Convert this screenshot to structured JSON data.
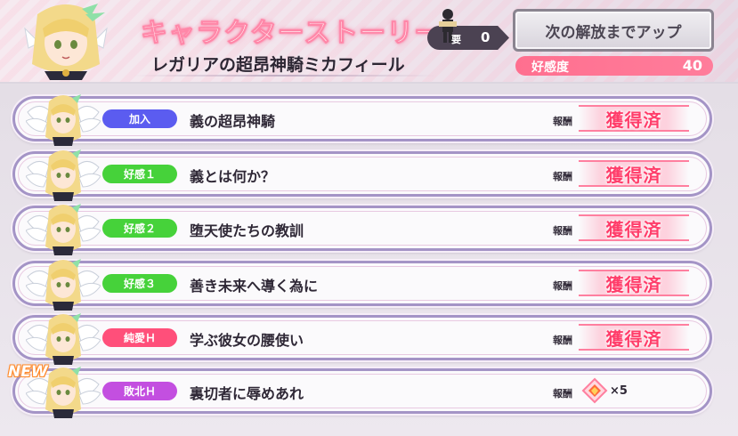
{
  "header": {
    "section_title": "キャラクターストーリー",
    "character_name": "レガリアの超昂神騎ミカフィール",
    "requirement": {
      "label": "要",
      "value": "0"
    },
    "unlock_button_label": "次の解放までアップ",
    "affection": {
      "label": "好感度",
      "value": "40"
    }
  },
  "colors": {
    "accent_pink": "#ff6f8f",
    "badge_join": "#5b5cf0",
    "badge_affection": "#46d23a",
    "badge_pure": "#ff4f7a",
    "badge_defeat": "#c34fe0"
  },
  "stories": [
    {
      "badge": "加入",
      "badge_color": "#5b5cf0",
      "title": "義の超昂神騎",
      "reward_label": "報酬",
      "reward": "獲得済"
    },
    {
      "badge": "好感１",
      "badge_color": "#46d23a",
      "title": "義とは何か？",
      "reward_label": "報酬",
      "reward": "獲得済"
    },
    {
      "badge": "好感２",
      "badge_color": "#46d23a",
      "title": "堕天使たちの教訓",
      "reward_label": "報酬",
      "reward": "獲得済"
    },
    {
      "badge": "好感３",
      "badge_color": "#46d23a",
      "title": "善き未来へ導く為に",
      "reward_label": "報酬",
      "reward": "獲得済"
    },
    {
      "badge": "純愛Ｈ",
      "badge_color": "#ff4f7a",
      "title": "学ぶ彼女の腰使い",
      "reward_label": "報酬",
      "reward": "獲得済"
    },
    {
      "badge": "敗北Ｈ",
      "badge_color": "#c34fe0",
      "title": "裏切者に辱めあれ",
      "reward_label": "報酬",
      "reward_item_icon": "crystal-gem-icon",
      "reward_qty": "×5",
      "new_tag": "NEW"
    }
  ]
}
